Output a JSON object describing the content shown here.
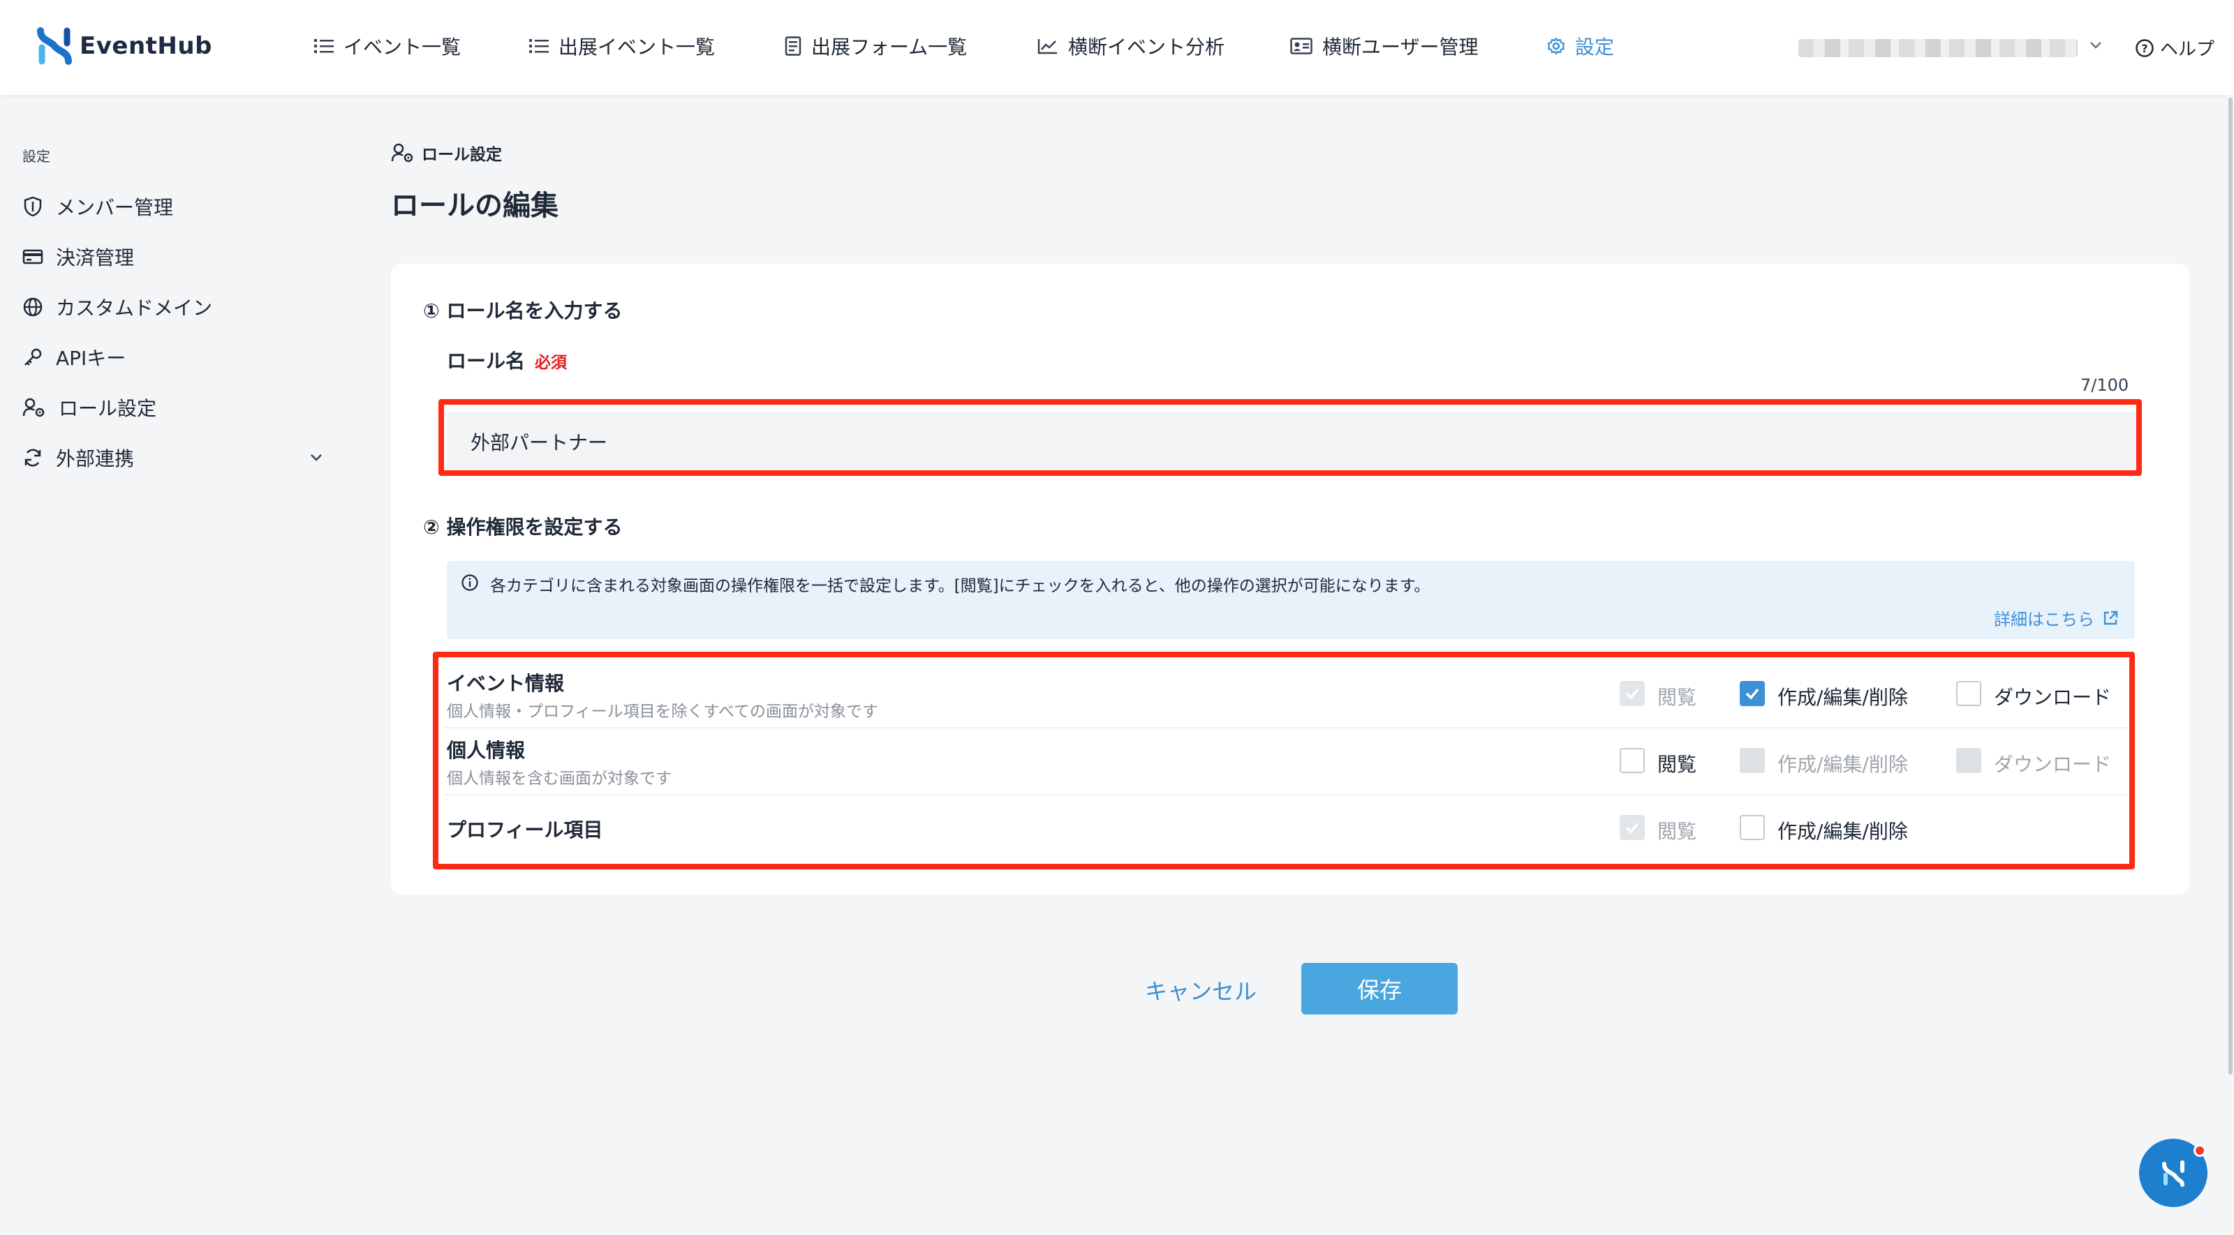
{
  "app": {
    "brand": "EventHub",
    "accent_color": "#3d8fd6",
    "highlight_color": "#ff2a14"
  },
  "nav": {
    "items": [
      {
        "label": "イベント一覧",
        "icon": "list-icon"
      },
      {
        "label": "出展イベント一覧",
        "icon": "list-icon"
      },
      {
        "label": "出展フォーム一覧",
        "icon": "form-icon"
      },
      {
        "label": "横断イベント分析",
        "icon": "chart-icon"
      },
      {
        "label": "横断ユーザー管理",
        "icon": "id-card-icon"
      },
      {
        "label": "設定",
        "icon": "gear-icon",
        "active": true
      }
    ],
    "help_label": "ヘルプ"
  },
  "sidebar": {
    "heading": "設定",
    "items": [
      {
        "label": "メンバー管理",
        "icon": "shield-icon"
      },
      {
        "label": "決済管理",
        "icon": "credit-card-icon"
      },
      {
        "label": "カスタムドメイン",
        "icon": "globe-icon"
      },
      {
        "label": "APIキー",
        "icon": "key-icon"
      },
      {
        "label": "ロール設定",
        "icon": "user-gear-icon"
      },
      {
        "label": "外部連携",
        "icon": "sync-icon"
      }
    ]
  },
  "breadcrumb": "ロール設定",
  "page_title": "ロールの編集",
  "form": {
    "section1_title": "① ロール名を入力する",
    "role_name_label": "ロール名",
    "required_label": "必須",
    "counter": "7/100",
    "role_name_value": "外部パートナー",
    "section2_title": "② 操作権限を設定する",
    "info_text": "各カテゴリに含まれる対象画面の操作権限を一括で設定します。[閲覧]にチェックを入れると、他の操作の選択が可能になります。",
    "info_link": "詳細はこちら",
    "permissions": [
      {
        "name": "イベント情報",
        "desc": "個人情報・プロフィール項目を除くすべての画面が対象です",
        "view": {
          "label": "閲覧",
          "state": "disabled-checked"
        },
        "edit": {
          "label": "作成/編集/削除",
          "state": "checked"
        },
        "download": {
          "label": "ダウンロード",
          "state": "unchecked"
        }
      },
      {
        "name": "個人情報",
        "desc": "個人情報を含む画面が対象です",
        "view": {
          "label": "閲覧",
          "state": "unchecked"
        },
        "edit": {
          "label": "作成/編集/削除",
          "state": "disabled"
        },
        "download": {
          "label": "ダウンロード",
          "state": "disabled"
        }
      },
      {
        "name": "プロフィール項目",
        "desc": "",
        "view": {
          "label": "閲覧",
          "state": "disabled-checked"
        },
        "edit": {
          "label": "作成/編集/削除",
          "state": "unchecked"
        }
      }
    ]
  },
  "actions": {
    "cancel_label": "キャンセル",
    "save_label": "保存"
  }
}
